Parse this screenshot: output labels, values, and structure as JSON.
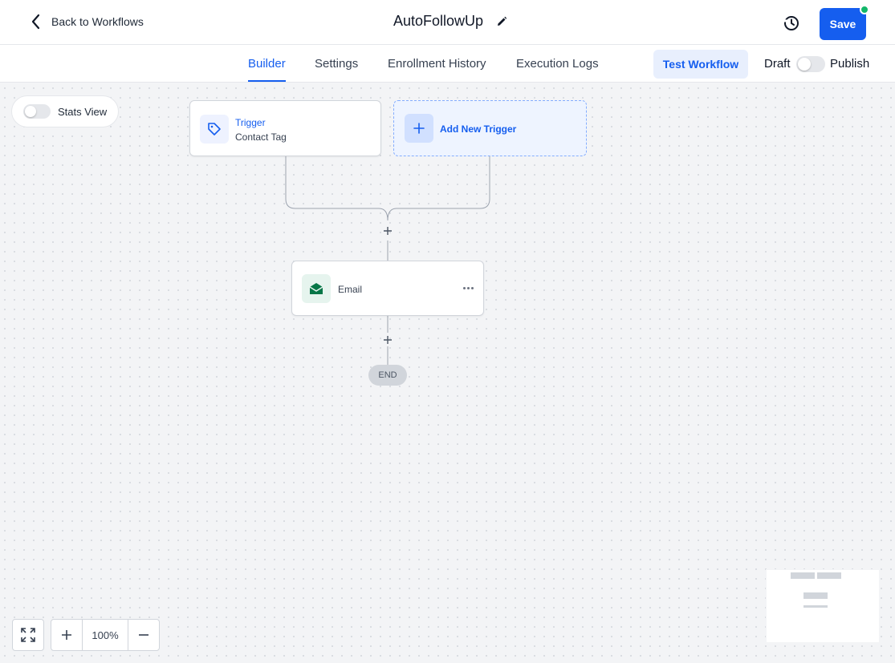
{
  "header": {
    "back_label": "Back to Workflows",
    "title": "AutoFollowUp",
    "save_label": "Save"
  },
  "tabs": [
    {
      "label": "Builder",
      "active": true
    },
    {
      "label": "Settings",
      "active": false
    },
    {
      "label": "Enrollment History",
      "active": false
    },
    {
      "label": "Execution Logs",
      "active": false
    }
  ],
  "actions": {
    "test_label": "Test Workflow",
    "draft_label": "Draft",
    "publish_label": "Publish",
    "published": false
  },
  "canvas": {
    "stats_label": "Stats View",
    "stats_enabled": false,
    "trigger": {
      "title": "Trigger",
      "subtitle": "Contact Tag",
      "icon": "tag-icon"
    },
    "add_trigger_label": "Add New Trigger",
    "steps": [
      {
        "label": "Email",
        "icon": "email-icon"
      }
    ],
    "end_label": "END"
  },
  "zoom": {
    "level": "100%"
  },
  "colors": {
    "accent": "#155eef",
    "save_status_dot": "#12b76a",
    "email_icon": "#067647"
  }
}
